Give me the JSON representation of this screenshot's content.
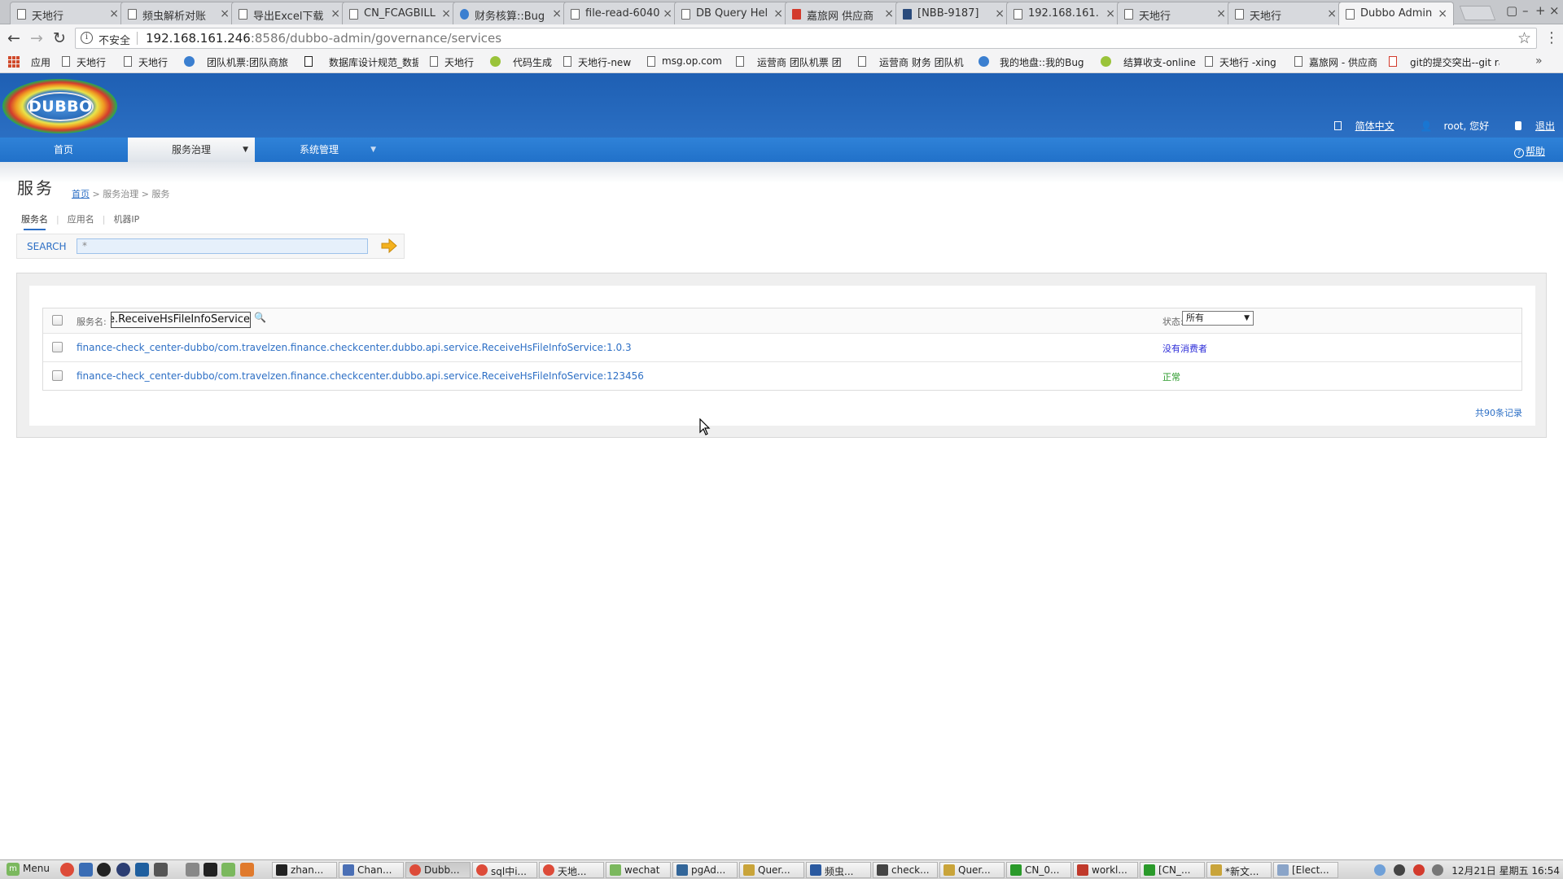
{
  "browser": {
    "tabs": [
      {
        "title": "天地行"
      },
      {
        "title": "频虫解析对账"
      },
      {
        "title": "导出Excel下载"
      },
      {
        "title": "CN_FCAGBILL"
      },
      {
        "title": "财务核算::Bug"
      },
      {
        "title": "file-read-6040"
      },
      {
        "title": "DB Query Hel"
      },
      {
        "title": "嘉旅网 供应商"
      },
      {
        "title": "[NBB-9187]"
      },
      {
        "title": "192.168.161."
      },
      {
        "title": "天地行"
      },
      {
        "title": "天地行"
      },
      {
        "title": "Dubbo Admin"
      }
    ],
    "security_label": "不安全",
    "url_host": "192.168.161.246",
    "url_rest": ":8586/dubbo-admin/governance/services",
    "bookmarks": [
      {
        "label": "应用"
      },
      {
        "label": "天地行"
      },
      {
        "label": "天地行"
      },
      {
        "label": "团队机票:团队商旅"
      },
      {
        "label": "数据库设计规范_数据"
      },
      {
        "label": "天地行"
      },
      {
        "label": "代码生成"
      },
      {
        "label": "天地行-new"
      },
      {
        "label": "msg.op.com"
      },
      {
        "label": "运营商 团队机票 团"
      },
      {
        "label": "运营商 财务 团队机"
      },
      {
        "label": "我的地盘::我的Bug"
      },
      {
        "label": "结算收支-online"
      },
      {
        "label": "天地行 -xing"
      },
      {
        "label": "嘉旅网 - 供应商"
      },
      {
        "label": "git的提交突出--git ra"
      }
    ]
  },
  "header": {
    "logo_text": "DUBBO",
    "lang_link": "简体中文",
    "user_greeting": "root, 您好",
    "logout_link": "退出"
  },
  "nav": {
    "items": [
      {
        "label": "首页"
      },
      {
        "label": "服务治理"
      },
      {
        "label": "系统管理"
      }
    ],
    "help": "帮助"
  },
  "page": {
    "title": "服务",
    "breadcrumb_home": "首页",
    "breadcrumb_rest": " > 服务治理 > 服务",
    "subtabs": [
      {
        "label": "服务名"
      },
      {
        "label": "应用名"
      },
      {
        "label": "机器IP"
      }
    ],
    "search_label": "SEARCH",
    "search_value": "*"
  },
  "table": {
    "filter_label": "服务名:",
    "filter_value": "finance-check_center-dubbo/com.travelzen.finance.checkcenter.dubbo.api.service.ReceiveHsFileInfoService",
    "status_label": "状态:",
    "status_selected": "所有",
    "rows": [
      {
        "service": "finance-check_center-dubbo/com.travelzen.finance.checkcenter.dubbo.api.service.ReceiveHsFileInfoService:1.0.3",
        "status": "没有消费者",
        "status_color": "#2d2dd8"
      },
      {
        "service": "finance-check_center-dubbo/com.travelzen.finance.checkcenter.dubbo.api.service.ReceiveHsFileInfoService:123456",
        "status": "正常",
        "status_color": "#2a9a2a"
      }
    ],
    "total": "共90条记录"
  },
  "taskbar": {
    "menu_label": "Menu",
    "windows": [
      {
        "label": "zhan...",
        "icon_color": "#222222"
      },
      {
        "label": "Chan...",
        "icon_color": "#4a6fb5"
      },
      {
        "label": "Dubb...",
        "icon_color": "#dd4b39"
      },
      {
        "label": "sql中i...",
        "icon_color": "#dd4b39"
      },
      {
        "label": "天地...",
        "icon_color": "#dd4b39"
      },
      {
        "label": "wechat",
        "icon_color": "#7bb85e"
      },
      {
        "label": "pgAd...",
        "icon_color": "#336699"
      },
      {
        "label": "Quer...",
        "icon_color": "#c9a43a"
      },
      {
        "label": "频虫...",
        "icon_color": "#2b5aa0"
      },
      {
        "label": "check...",
        "icon_color": "#444444"
      },
      {
        "label": "Quer...",
        "icon_color": "#c9a43a"
      },
      {
        "label": "CN_0...",
        "icon_color": "#2a9a2a"
      },
      {
        "label": "workl...",
        "icon_color": "#c0392b"
      },
      {
        "label": "[CN_...",
        "icon_color": "#2a9a2a"
      },
      {
        "label": "*新文...",
        "icon_color": "#c9a43a"
      },
      {
        "label": "[Elect...",
        "icon_color": "#8aa4c8"
      }
    ],
    "clock": "12月21日 星期五 16:54"
  }
}
